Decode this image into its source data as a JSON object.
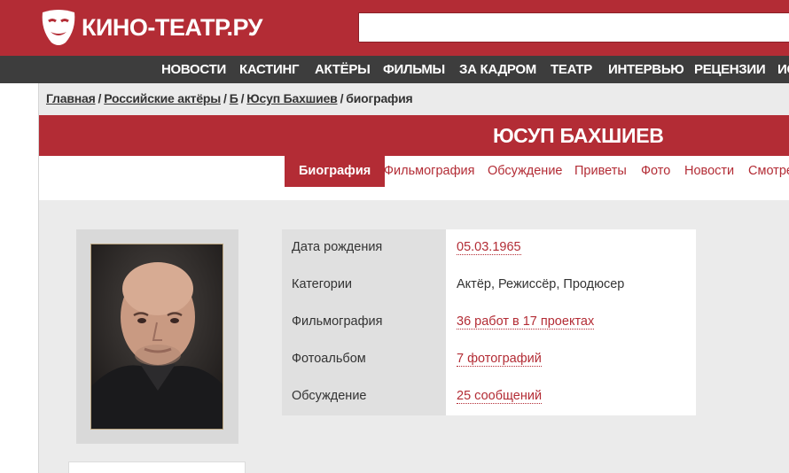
{
  "header": {
    "logo_text": "КИНО-ТЕАТР.РУ",
    "brand_color": "#b32c35"
  },
  "nav": {
    "items": [
      "НОВОСТИ",
      "КАСТИНГ",
      "АКТЁРЫ",
      "ФИЛЬМЫ",
      "ЗА КАДРОМ",
      "ТЕАТР",
      "ИНТЕРВЬЮ",
      "РЕЦЕНЗИИ",
      "ИС"
    ]
  },
  "breadcrumb": {
    "items": [
      "Главная",
      "Российские актёры",
      "Б",
      "Юсуп Бахшиев"
    ],
    "current": "биография",
    "separator": "/"
  },
  "page": {
    "title": "ЮСУП БАХШИЕВ"
  },
  "tabs": [
    "Биография",
    "Фильмография",
    "Обсуждение",
    "Приветы",
    "Фото",
    "Новости",
    "Смотре"
  ],
  "info": [
    {
      "label": "Дата рождения",
      "value": "05.03.1965",
      "link": true
    },
    {
      "label": "Категории",
      "value": "Актёр, Режиссёр, Продюсер",
      "link": false
    },
    {
      "label": "Фильмография",
      "value": "36 работ в 17 проектах",
      "link": true
    },
    {
      "label": "Фотоальбом",
      "value": "7 фотографий",
      "link": true
    },
    {
      "label": "Обсуждение",
      "value": "25 сообщений",
      "link": true
    }
  ]
}
